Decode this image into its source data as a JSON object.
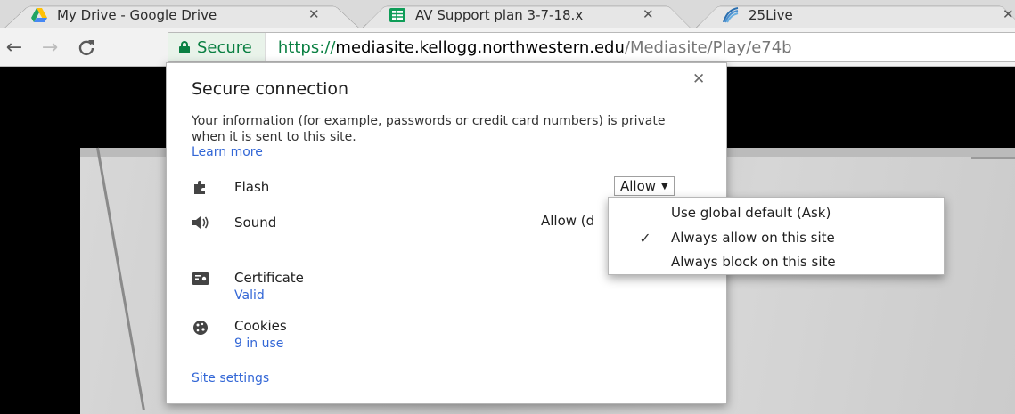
{
  "tabs": [
    {
      "title": "My Drive - Google Drive",
      "favicon": "google-drive-icon"
    },
    {
      "title": "AV Support plan 3-7-18.x",
      "favicon": "sheets-icon"
    },
    {
      "title": "25Live",
      "favicon": "25live-icon"
    }
  ],
  "omnibox": {
    "secure_label": "Secure",
    "url_scheme": "https://",
    "url_host": "mediasite.kellogg.northwestern.edu",
    "url_path": "/Mediasite/Play/e74b"
  },
  "popup": {
    "title": "Secure connection",
    "description": "Your information (for example, passwords or credit card numbers) is private when it is sent to this site.",
    "learn_more": "Learn more",
    "permissions": [
      {
        "label": "Flash",
        "value": "Allow",
        "icon": "puzzle-icon"
      },
      {
        "label": "Sound",
        "value": "Allow (d",
        "icon": "speaker-icon"
      }
    ],
    "certificate": {
      "label": "Certificate",
      "status": "Valid"
    },
    "cookies": {
      "label": "Cookies",
      "status": "9 in use"
    },
    "site_settings": "Site settings"
  },
  "flash_menu": {
    "options": [
      {
        "label": "Use global default (Ask)",
        "checked": false
      },
      {
        "label": "Always allow on this site",
        "checked": true
      },
      {
        "label": "Always block on this site",
        "checked": false
      }
    ]
  },
  "colors": {
    "secure_green": "#0b8043",
    "link_blue": "#3367d6"
  }
}
